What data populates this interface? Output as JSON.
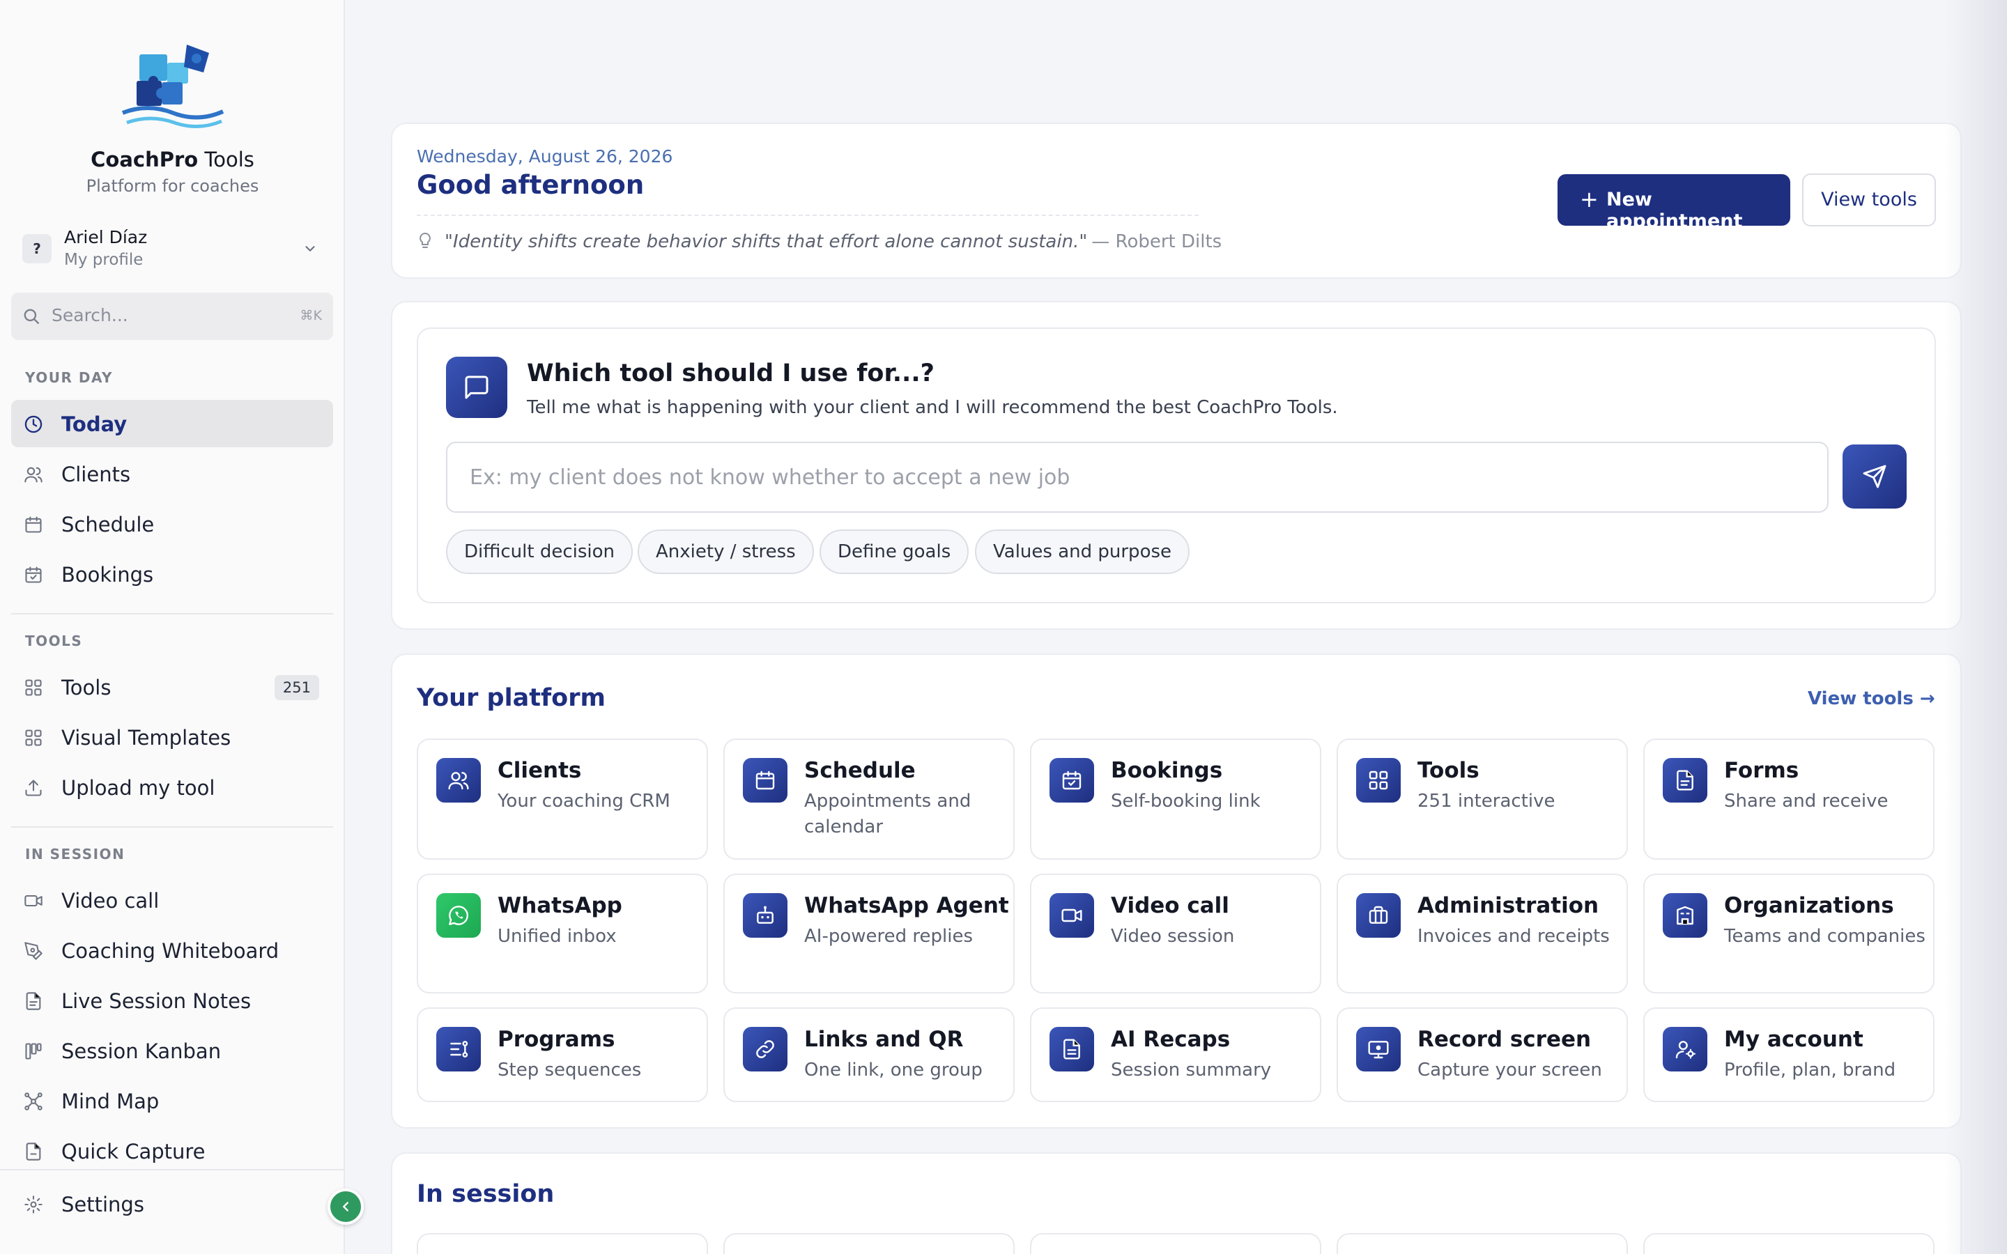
{
  "sidebar": {
    "brand_strong": "CoachPro",
    "brand_rest": " Tools",
    "tagline": "Platform for coaches",
    "profile": {
      "avatar": "?",
      "name": "Ariel Díaz",
      "subtitle": "My profile"
    },
    "search": {
      "placeholder": "Search...",
      "shortcut": "⌘K"
    },
    "sections": [
      {
        "title": "YOUR DAY",
        "items": [
          {
            "label": "Today",
            "icon": "clock-icon",
            "active": true
          },
          {
            "label": "Clients",
            "icon": "users-icon"
          },
          {
            "label": "Schedule",
            "icon": "calendar-icon"
          },
          {
            "label": "Bookings",
            "icon": "calendar-check-icon"
          }
        ]
      },
      {
        "title": "TOOLS",
        "items": [
          {
            "label": "Tools",
            "icon": "grid-icon",
            "badge": "251"
          },
          {
            "label": "Visual Templates",
            "icon": "grid-icon"
          },
          {
            "label": "Upload my tool",
            "icon": "upload-icon"
          }
        ]
      },
      {
        "title": "IN SESSION",
        "items": [
          {
            "label": "Video call",
            "icon": "video-icon"
          },
          {
            "label": "Coaching Whiteboard",
            "icon": "pen-tool-icon"
          },
          {
            "label": "Live Session Notes",
            "icon": "file-text-icon"
          },
          {
            "label": "Session Kanban",
            "icon": "kanban-icon"
          },
          {
            "label": "Mind Map",
            "icon": "network-icon"
          },
          {
            "label": "Quick Capture",
            "icon": "file-icon"
          }
        ]
      }
    ],
    "settings_label": "Settings"
  },
  "header": {
    "date": "Wednesday, August 26, 2026",
    "greeting": "Good afternoon",
    "quote": "\"Identity shifts create behavior shifts that effort alone cannot sustain.\"",
    "quote_author": "— Robert Dilts",
    "new_appointment_label": "New appointment",
    "view_tools_label": "View tools"
  },
  "assistant": {
    "title": "Which tool should I use for...?",
    "subtitle": "Tell me what is happening with your client and I will recommend the best CoachPro Tools.",
    "input_placeholder": "Ex: my client does not know whether to accept a new job",
    "chips": [
      "Difficult decision",
      "Anxiety / stress",
      "Define goals",
      "Values and purpose"
    ]
  },
  "platform": {
    "title": "Your platform",
    "view_tools_link": "View tools →",
    "tiles": [
      {
        "title": "Clients",
        "subtitle": "Your coaching CRM",
        "icon": "users-icon"
      },
      {
        "title": "Schedule",
        "subtitle": "Appointments and calendar",
        "icon": "calendar-icon"
      },
      {
        "title": "Bookings",
        "subtitle": "Self-booking link",
        "icon": "calendar-check-icon"
      },
      {
        "title": "Tools",
        "subtitle": "251 interactive",
        "icon": "grid-icon"
      },
      {
        "title": "Forms",
        "subtitle": "Share and receive",
        "icon": "file-text-icon"
      },
      {
        "title": "WhatsApp",
        "subtitle": "Unified inbox",
        "icon": "whatsapp-icon"
      },
      {
        "title": "WhatsApp Agent",
        "subtitle": "AI-powered replies",
        "icon": "bot-icon"
      },
      {
        "title": "Video call",
        "subtitle": "Video session",
        "icon": "video-icon"
      },
      {
        "title": "Administration",
        "subtitle": "Invoices and receipts",
        "icon": "briefcase-icon"
      },
      {
        "title": "Organizations",
        "subtitle": "Teams and companies",
        "icon": "building-icon"
      },
      {
        "title": "Programs",
        "subtitle": "Step sequences",
        "icon": "list-steps-icon"
      },
      {
        "title": "Links and QR",
        "subtitle": "One link, one group",
        "icon": "link-icon"
      },
      {
        "title": "AI Recaps",
        "subtitle": "Session summary",
        "icon": "document-icon"
      },
      {
        "title": "Record screen",
        "subtitle": "Capture your screen",
        "icon": "monitor-record-icon"
      },
      {
        "title": "My account",
        "subtitle": "Profile, plan, brand",
        "icon": "user-cog-icon"
      }
    ]
  },
  "in_session": {
    "title": "In session"
  },
  "colors": {
    "primary": "#1e2f80",
    "accent": "#3b56b9",
    "whatsapp": "#1da851",
    "collapse": "#2f9a5f"
  }
}
